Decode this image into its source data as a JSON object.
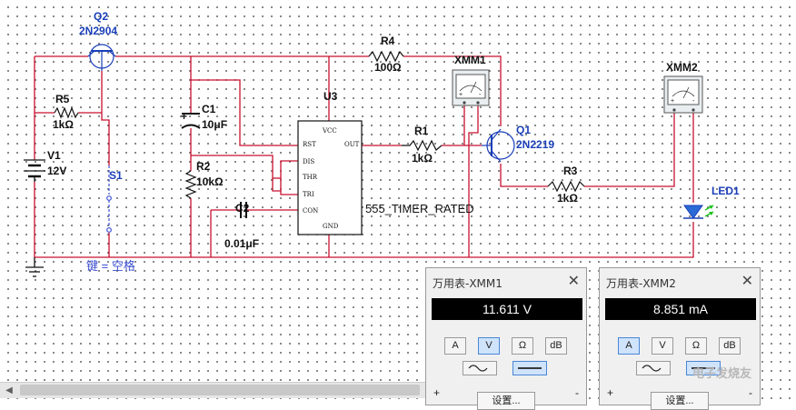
{
  "schematic": {
    "components": {
      "q2": {
        "ref": "Q2",
        "model": "2N2904"
      },
      "r4": {
        "ref": "R4",
        "value": "100Ω"
      },
      "xmm1": {
        "ref": "XMM1"
      },
      "xmm2": {
        "ref": "XMM2"
      },
      "r5": {
        "ref": "R5",
        "value": "1kΩ"
      },
      "c1": {
        "ref": "C1",
        "value": "10μF"
      },
      "u3": {
        "ref": "U3",
        "model": "555_TIMER_RATED",
        "pins": {
          "vcc": "VCC",
          "rst": "RST",
          "out": "OUT",
          "dis": "DIS",
          "thr": "THR",
          "tri": "TRI",
          "con": "CON",
          "gnd": "GND"
        }
      },
      "r1": {
        "ref": "R1",
        "value": "1kΩ"
      },
      "q1": {
        "ref": "Q1",
        "model": "2N2219"
      },
      "v1": {
        "ref": "V1",
        "value": "12V"
      },
      "r2": {
        "ref": "R2",
        "value": "10kΩ"
      },
      "s1": {
        "ref": "S1",
        "key_hint": "键 = 空格"
      },
      "r3": {
        "ref": "R3",
        "value": "1kΩ"
      },
      "led1": {
        "ref": "LED1"
      },
      "c2": {
        "ref": "C2",
        "value": "0.01μF"
      }
    },
    "colors": {
      "wire": "#c8102e",
      "dots": "#6a6a6a",
      "label_blue": "#1a3fb8",
      "switch": "#3c4fd0",
      "led": "#2a6bd6",
      "led_arrows": "#1ec31e"
    }
  },
  "multimeter1": {
    "title": "万用表-XMM1",
    "reading": "11.611 V",
    "modes": [
      "A",
      "V",
      "Ω",
      "dB"
    ],
    "active_mode": "V",
    "settings_label": "设置...",
    "plus": "+",
    "minus": "-"
  },
  "multimeter2": {
    "title": "万用表-XMM2",
    "reading": "8.851 mA",
    "modes": [
      "A",
      "V",
      "Ω",
      "dB"
    ],
    "active_mode": "A",
    "settings_label": "设置...",
    "plus": "+",
    "minus": "-"
  },
  "watermark": "电子发烧友"
}
